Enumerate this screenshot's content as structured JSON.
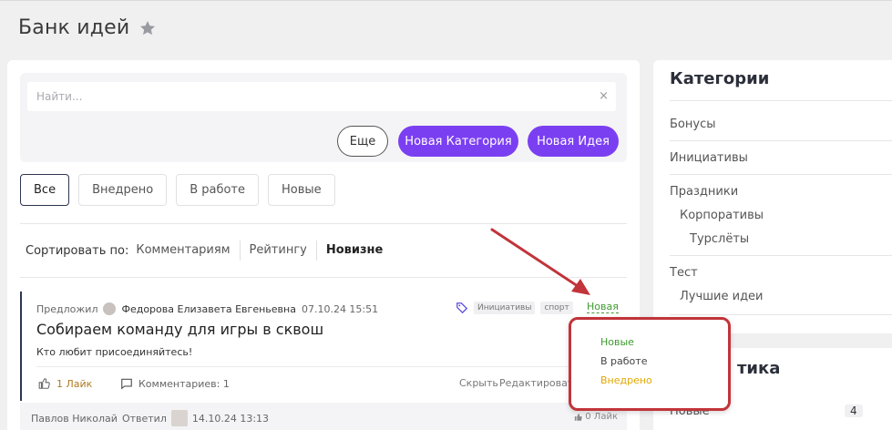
{
  "page": {
    "title": "Банк идей"
  },
  "search": {
    "placeholder": "Найти...",
    "clear": "×"
  },
  "buttons": {
    "more": "Еще",
    "new_category": "Новая Категория",
    "new_idea": "Новая Идея"
  },
  "filters": [
    "Все",
    "Внедрено",
    "В работе",
    "Новые"
  ],
  "sort": {
    "label": "Сортировать по:",
    "options": [
      "Комментариям",
      "Рейтингу",
      "Новизне"
    ]
  },
  "idea": {
    "proposed_label": "Предложил",
    "author": "Федорова Елизавета Евгеньевна",
    "date": "07.10.24 15:51",
    "tags": [
      "Инициативы",
      "спорт"
    ],
    "status": "Новая",
    "title": "Собираем команду для игры в сквош",
    "text": "Кто любит присоединяйтесь!",
    "likes": "1 Лайк",
    "comments": "Комментариев: 1",
    "hide": "Скрыть",
    "edit": "Редактировать"
  },
  "reply": {
    "author": "Павлов Николай",
    "replied_label": "Ответил",
    "date": "14.10.24 13:13",
    "likes": "0 Лайк"
  },
  "categories": {
    "title": "Категории",
    "items": [
      "Бонусы",
      "Инициативы",
      "Праздники",
      "Корпоративы",
      "Турслёты",
      "Тест",
      "Лучшие идеи"
    ]
  },
  "stats": {
    "title": "тика",
    "items": [
      {
        "name": "Новые",
        "count": "4"
      }
    ]
  },
  "status_menu": {
    "items": [
      {
        "label": "Новые",
        "color": "#3e9a2e"
      },
      {
        "label": "В работе",
        "color": "#444444"
      },
      {
        "label": "Внедрено",
        "color": "#e0a800"
      }
    ]
  },
  "colors": {
    "accent": "#7b3ff2",
    "annotation": "#c1343a"
  }
}
